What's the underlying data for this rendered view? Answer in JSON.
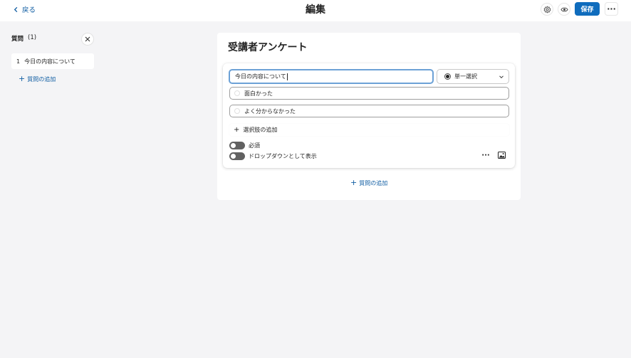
{
  "header": {
    "back_label": "戻る",
    "title": "編集",
    "settings_icon": "gear-icon",
    "preview_icon": "eye-icon",
    "save_label": "保存",
    "more_label": "···"
  },
  "sidebar": {
    "title": "質問",
    "count": "(1)",
    "items": [
      {
        "number": "1",
        "label": "今日の内容について"
      }
    ],
    "add_label": "質問の追加"
  },
  "form": {
    "title": "受講者アンケート",
    "question": {
      "text": "今日の内容について",
      "type_label": "単一選択",
      "options": [
        {
          "label": "面白かった"
        },
        {
          "label": "よく分からなかった"
        }
      ],
      "add_choice_label": "選択肢の追加",
      "required_label": "必須",
      "dropdown_label": "ドロップダウンとして表示",
      "more_label": "···"
    },
    "add_question_label": "質問の追加"
  },
  "colors": {
    "accent": "#0f6cbd",
    "link": "#115ea3",
    "background": "#f4f4f6",
    "toggle_off": "#616161"
  }
}
